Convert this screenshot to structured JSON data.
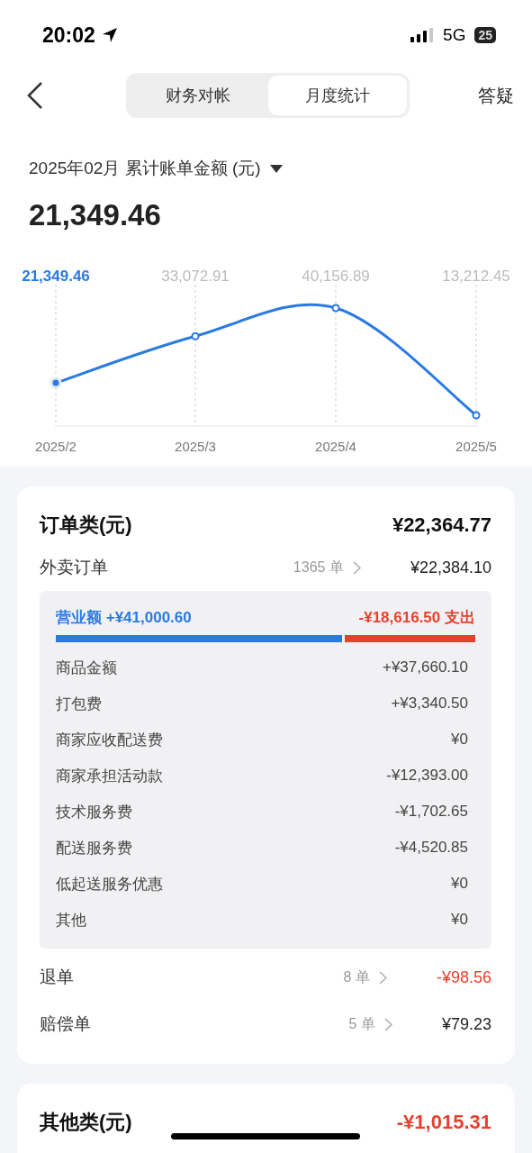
{
  "status_bar": {
    "time": "20:02",
    "network": "5G",
    "battery": "25"
  },
  "nav": {
    "tabs": [
      {
        "label": "财务对帐",
        "selected": false
      },
      {
        "label": "月度统计",
        "selected": true
      }
    ],
    "action": "答疑"
  },
  "summary": {
    "period": "2025年02月",
    "title": "累计账单金额 (元)",
    "amount": "21,349.46"
  },
  "trend": {
    "points": [
      {
        "selected": true
      },
      {
        "selected": false
      },
      {
        "selected": false
      },
      {
        "selected": false
      }
    ],
    "chart_data": {
      "type": "line",
      "categories": [
        "2025/2",
        "2025/3",
        "2025/4",
        "2025/5"
      ],
      "grid": true,
      "series": [
        {
          "color": "#2a7ae2",
          "marker": "circle",
          "value_labels": [
            "21,349.46",
            "33,072.91",
            "40,156.89",
            "13,212.45"
          ],
          "values": [
            21349.46,
            33072.91,
            40156.89,
            13212.45
          ]
        }
      ]
    }
  },
  "order_card": {
    "title": "订单类(元)",
    "total": "¥22,364.77",
    "rows": [
      {
        "label": "外卖订单",
        "count": "1365 单",
        "amount": "¥22,384.10",
        "negative": false,
        "expanded": true
      },
      {
        "label": "退单",
        "count": "8 单",
        "amount": "-¥98.56",
        "negative": true,
        "expanded": false
      },
      {
        "label": "赔偿单",
        "count": "5 单",
        "amount": "¥79.23",
        "negative": false,
        "expanded": false
      }
    ],
    "breakdown": {
      "revenue": "营业额 +¥41,000.60",
      "expense": "-¥18,616.50 支出",
      "level": 0.688,
      "items": [
        {
          "label": "商品金额",
          "amount": "+¥37,660.10"
        },
        {
          "label": "打包费",
          "amount": "+¥3,340.50"
        },
        {
          "label": "商家应收配送费",
          "amount": "¥0"
        },
        {
          "label": "商家承担活动款",
          "amount": "-¥12,393.00"
        },
        {
          "label": "技术服务费",
          "amount": "-¥1,702.65"
        },
        {
          "label": "配送服务费",
          "amount": "-¥4,520.85"
        },
        {
          "label": "低起送服务优惠",
          "amount": "¥0"
        },
        {
          "label": "其他",
          "amount": "¥0"
        }
      ]
    }
  },
  "other_card": {
    "title": "其他类(元)",
    "total": "-¥1,015.31",
    "negative": true
  }
}
